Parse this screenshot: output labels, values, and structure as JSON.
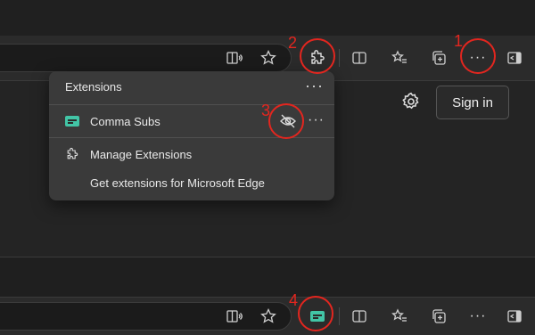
{
  "extensions_menu": {
    "title": "Extensions",
    "more_label": "···",
    "items": [
      {
        "label": "Comma Subs",
        "more_label": "···"
      },
      {
        "label": "Manage Extensions"
      },
      {
        "label": "Get extensions for Microsoft Edge"
      }
    ]
  },
  "page": {
    "sign_in_label": "Sign in"
  },
  "toolbar": {
    "more_label": "···"
  },
  "annotations": [
    "1",
    "2",
    "3",
    "4"
  ],
  "colors": {
    "annotation": "#e3261f",
    "extension_accent": "#42c5a6",
    "menu_bg": "#3a3a3a"
  }
}
